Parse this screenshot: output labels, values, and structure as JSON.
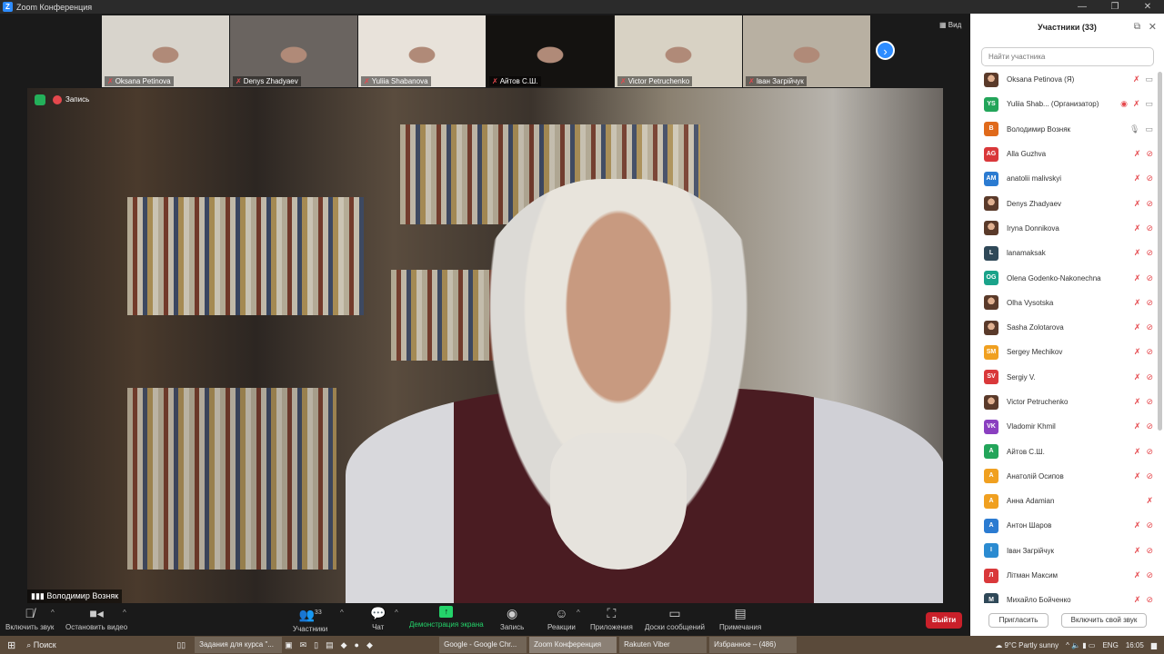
{
  "window": {
    "title": "Zoom Конференция",
    "minimize": "—",
    "maximize": "❐",
    "close": "✕"
  },
  "thumbnails": [
    {
      "name": "Oksana Petinova",
      "bg": "#d8d4cc"
    },
    {
      "name": "Denys Zhadyaev",
      "bg": "#6a6460"
    },
    {
      "name": "Yuliia Shabanova",
      "bg": "#e8e2da"
    },
    {
      "name": "Айтов  С.Ш.",
      "bg": "#141210"
    },
    {
      "name": "Victor Petruchenko",
      "bg": "#d8d2c4"
    },
    {
      "name": "Іван Загрійчук",
      "bg": "#b8b0a2"
    }
  ],
  "view_label": "Вид",
  "main_video": {
    "recording_label": "Запись",
    "speaker": "Володимир Возняк"
  },
  "toolbar": {
    "unmute": "Включить звук",
    "stop_video": "Остановить видео",
    "participants": "Участники",
    "participants_count": "33",
    "chat": "Чат",
    "share": "Демонстрация экрана",
    "record": "Запись",
    "reactions": "Реакции",
    "apps": "Приложения",
    "whiteboards": "Доски сообщений",
    "notes": "Примечания",
    "leave": "Выйти"
  },
  "panel": {
    "title": "Участники (33)",
    "search_placeholder": "Найти участника",
    "participants": [
      {
        "name": "Oksana Petinova (Я)",
        "initials": "",
        "color": "",
        "mic": "off",
        "video": "on"
      },
      {
        "name": "Yuliia Shab...  (Организатор)",
        "initials": "YS",
        "color": "#23a55a",
        "mic": "off",
        "video": "on",
        "rec": true
      },
      {
        "name": "Володимир Возняк",
        "initials": "В",
        "color": "#e06a1b",
        "mic": "on",
        "video": "on"
      },
      {
        "name": "Alla Guzhva",
        "initials": "AG",
        "color": "#d9383a",
        "mic": "off",
        "video": "off"
      },
      {
        "name": "anatolii malivskyi",
        "initials": "AM",
        "color": "#2b7bd1",
        "mic": "off",
        "video": "off"
      },
      {
        "name": "Denys Zhadyaev",
        "initials": "",
        "color": "",
        "mic": "off",
        "video": "off"
      },
      {
        "name": "Iryna Donnikova",
        "initials": "",
        "color": "",
        "mic": "off",
        "video": "off"
      },
      {
        "name": "lanamaksak",
        "initials": "L",
        "color": "#2f4858",
        "mic": "off",
        "video": "off"
      },
      {
        "name": "Olena Godenko-Nakonechna",
        "initials": "OG",
        "color": "#1aa38a",
        "mic": "off",
        "video": "off"
      },
      {
        "name": "Olha Vysotska",
        "initials": "",
        "color": "",
        "mic": "off",
        "video": "off"
      },
      {
        "name": "Sasha Zolotarova",
        "initials": "",
        "color": "",
        "mic": "off",
        "video": "off"
      },
      {
        "name": "Sergey Mechikov",
        "initials": "SM",
        "color": "#f0a020",
        "mic": "off",
        "video": "off"
      },
      {
        "name": "Sergiy V.",
        "initials": "SV",
        "color": "#d9383a",
        "mic": "off",
        "video": "off"
      },
      {
        "name": "Victor Petruchenko",
        "initials": "",
        "color": "",
        "mic": "off",
        "video": "off"
      },
      {
        "name": "Vladomir Khmil",
        "initials": "VK",
        "color": "#8a3fc0",
        "mic": "off",
        "video": "off"
      },
      {
        "name": "Айтов  С.Ш.",
        "initials": "А",
        "color": "#23a55a",
        "mic": "off",
        "video": "off"
      },
      {
        "name": "Анатолій Осипов",
        "initials": "А",
        "color": "#f0a020",
        "mic": "off",
        "video": "off"
      },
      {
        "name": "Анна Adamian",
        "initials": "А",
        "color": "#f0a020",
        "mic": "off",
        "video": "none"
      },
      {
        "name": "Антон Шаров",
        "initials": "А",
        "color": "#2b7bd1",
        "mic": "off",
        "video": "off"
      },
      {
        "name": "Іван Загрійчук",
        "initials": "І",
        "color": "#2b8bd1",
        "mic": "off",
        "video": "off"
      },
      {
        "name": "Літман Максим",
        "initials": "Л",
        "color": "#d9383a",
        "mic": "off",
        "video": "off"
      },
      {
        "name": "Михайло Бойченко",
        "initials": "М",
        "color": "#2f4858",
        "mic": "off",
        "video": "off"
      }
    ],
    "invite": "Пригласить",
    "unmute_me": "Включить свой звук"
  },
  "taskbar": {
    "search": "Поиск",
    "tasks": [
      "Задания для курса \"...",
      "Google - Google Chr...",
      "Zoom Конференция",
      "Rakuten Viber",
      "Избранное – (486)"
    ],
    "weather": "9°C  Partly sunny",
    "lang": "ENG",
    "time": "16:05"
  }
}
